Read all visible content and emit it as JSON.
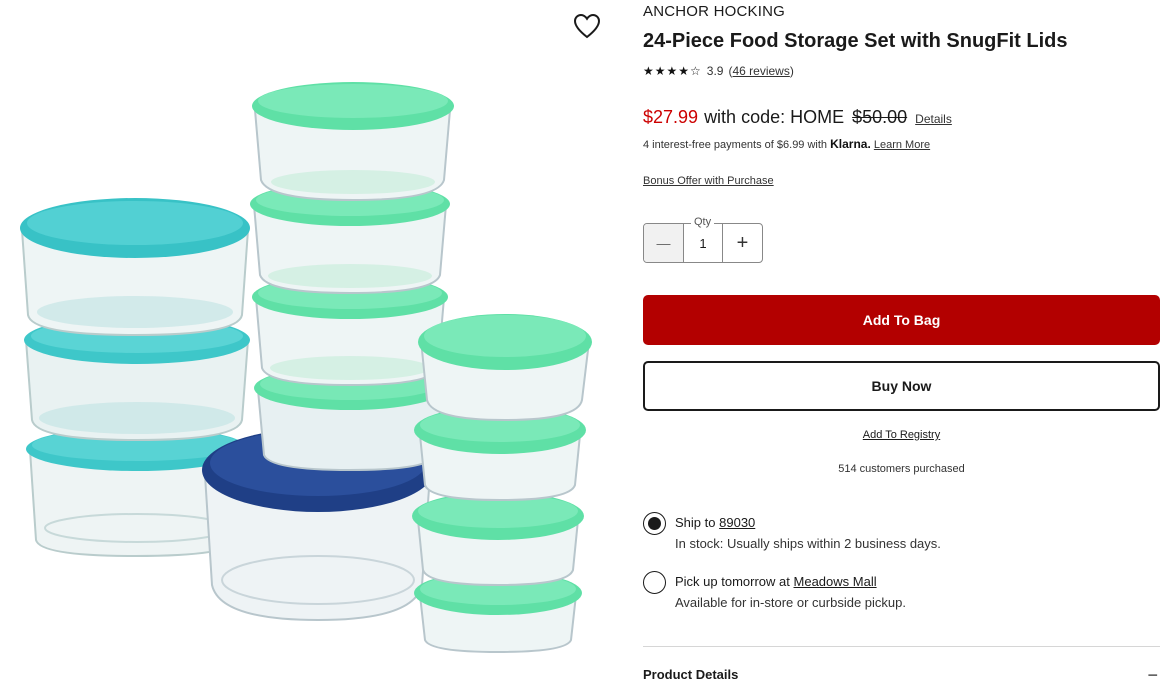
{
  "product": {
    "brand": "ANCHOR HOCKING",
    "title": "24-Piece Food Storage Set with SnugFit Lids",
    "stars": "★★★★☆",
    "rating": "3.9",
    "reviews": "46 reviews",
    "image_alt": "24-Piece Food Storage Set with SnugFit Lids"
  },
  "pricing": {
    "sale_price": "$27.99",
    "with_code": "with code: HOME",
    "original_price": "$50.00",
    "details_link": "Details",
    "klarna_text": "4 interest-free payments of $6.99 with",
    "klarna_brand": "Klarna.",
    "klarna_learn_more": "Learn More",
    "bonus_offer": "Bonus Offer with Purchase"
  },
  "quantity": {
    "label": "Qty",
    "value": "1",
    "minus_symbol": "—",
    "plus_symbol": "+"
  },
  "actions": {
    "add_to_bag": "Add To Bag",
    "buy_now": "Buy Now",
    "add_to_registry": "Add To Registry",
    "customers_purchased": "514 customers purchased"
  },
  "fulfillment": {
    "ship": {
      "label": "Ship",
      "to": "to",
      "zip": "89030",
      "status": "In stock: Usually ships within 2 business days.",
      "selected": true
    },
    "pickup": {
      "label": "Pick up tomorrow",
      "at": "at",
      "store": "Meadows Mall",
      "status": "Available for in-store or curbside pickup.",
      "selected": false
    }
  },
  "details_section": {
    "title": "Product Details",
    "toggle": "−"
  },
  "colors": {
    "sale_red": "#cc0000",
    "add_to_bag_bg": "#b30000",
    "lid_teal": "#3ec7c9",
    "lid_mint": "#5fe0a6",
    "lid_navy": "#1f3f86"
  },
  "icons": {
    "favorite": "heart-icon",
    "minus": "minus-icon",
    "plus": "plus-icon"
  }
}
